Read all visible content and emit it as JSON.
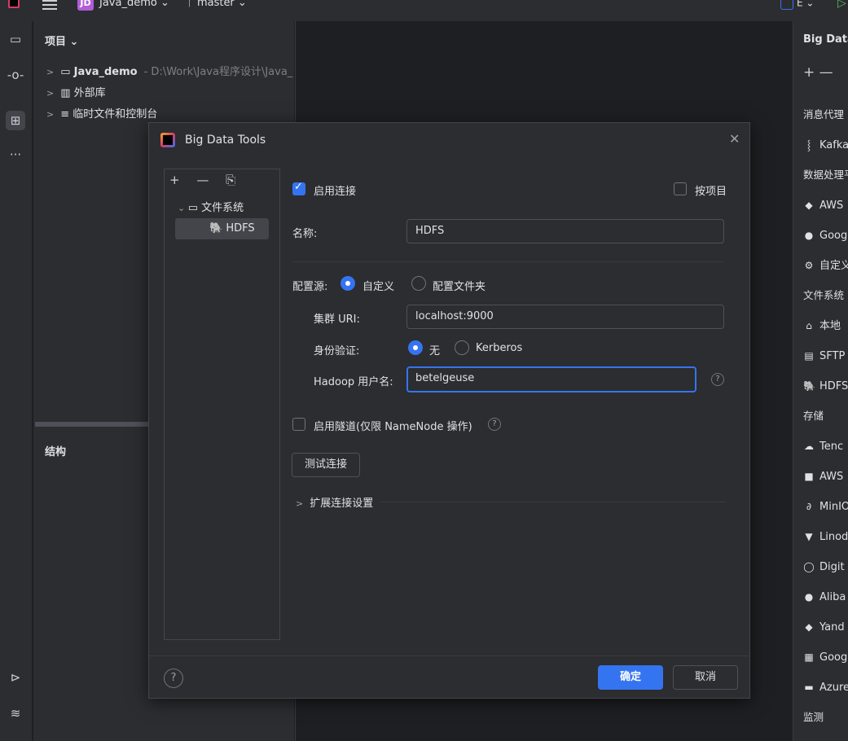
{
  "titlebar": {
    "project_badge": "JD",
    "project_name": "Java_demo ⌄",
    "branch": "master ⌄",
    "right_label": "E ⌄"
  },
  "left_strip": {
    "icons": [
      "folder-icon",
      "commit-icon",
      "plugins-icon",
      "more-icon",
      "run-services-icon",
      "layers-icon"
    ]
  },
  "project_panel": {
    "header": "项目 ⌄",
    "tree": [
      {
        "label": "Java_demo",
        "path": "- D:\\Work\\Java程序设计\\Java_"
      },
      {
        "label": "外部库"
      },
      {
        "label": "临时文件和控制台"
      }
    ],
    "structure_label": "结构"
  },
  "right_panel": {
    "title": "Big Data",
    "toolbar": "+ —",
    "items": [
      {
        "label": "消息代理",
        "section": true,
        "icon": ""
      },
      {
        "label": "Kafka",
        "icon": "⸾"
      },
      {
        "label": "数据处理平台",
        "section": true,
        "icon": ""
      },
      {
        "label": "AWS",
        "icon": "◆"
      },
      {
        "label": "Goog",
        "icon": "●"
      },
      {
        "label": "自定义",
        "icon": "⚙"
      },
      {
        "label": "文件系统",
        "section": true,
        "icon": ""
      },
      {
        "label": "本地",
        "icon": "⌂"
      },
      {
        "label": "SFTP",
        "icon": "▤"
      },
      {
        "label": "HDFS",
        "icon": "🐘"
      },
      {
        "label": "存储",
        "section": true,
        "icon": ""
      },
      {
        "label": "Tenc",
        "icon": "☁"
      },
      {
        "label": "AWS",
        "icon": "■"
      },
      {
        "label": "MinIO",
        "icon": "∂"
      },
      {
        "label": "Linod",
        "icon": "▼"
      },
      {
        "label": "Digit",
        "icon": "◯"
      },
      {
        "label": "Aliba",
        "icon": "●"
      },
      {
        "label": "Yand",
        "icon": "◆"
      },
      {
        "label": "Goog",
        "icon": "▦"
      },
      {
        "label": "Azure",
        "icon": "▬"
      },
      {
        "label": "监测",
        "section": true,
        "icon": ""
      }
    ]
  },
  "dialog": {
    "title": "Big Data Tools",
    "list_tools": "+ — ⎘",
    "tree_folder": "文件系统",
    "tree_item": "HDFS",
    "enable_connection": "启用连接",
    "per_project": "按项目",
    "name_label": "名称:",
    "name_value": "HDFS",
    "config_source_label": "配置源:",
    "config_custom": "自定义",
    "config_folder": "配置文件夹",
    "cluster_uri_label": "集群 URI:",
    "cluster_uri_value": "localhost:9000",
    "auth_label": "身份验证:",
    "auth_none": "无",
    "auth_kerberos": "Kerberos",
    "hadoop_user_label": "Hadoop 用户名:",
    "hadoop_user_value": "betelgeuse",
    "enable_tunnel": "启用隧道(仅限 NameNode 操作)",
    "test_connection": "测试连接",
    "advanced_settings": "扩展连接设置",
    "ok": "确定",
    "cancel": "取消",
    "help_symbol": "?"
  }
}
